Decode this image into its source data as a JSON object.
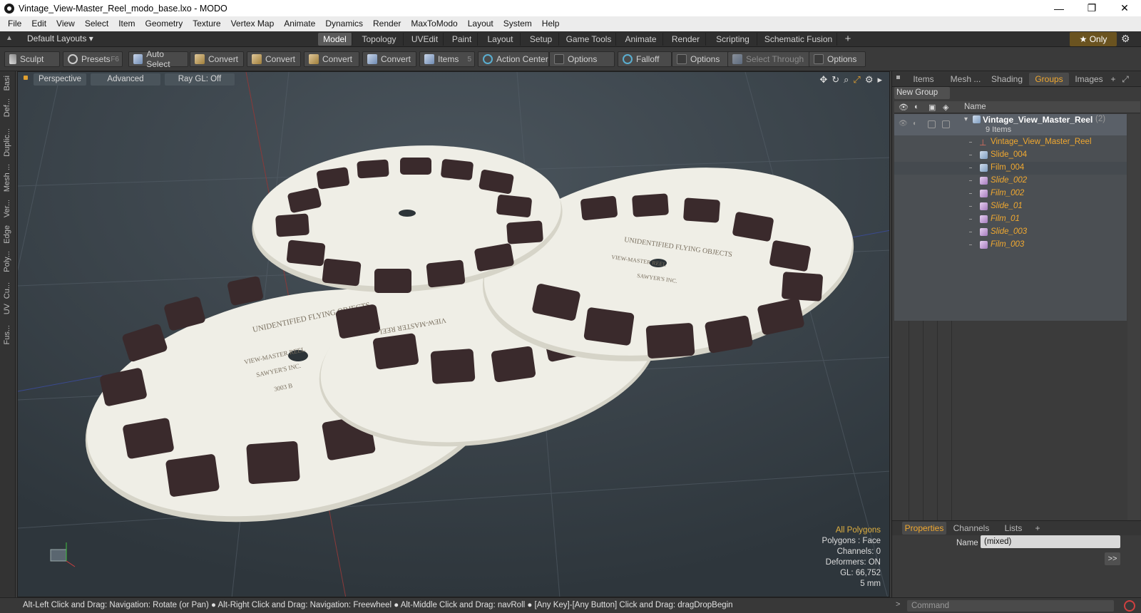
{
  "window": {
    "title": "Vintage_View-Master_Reel_modo_base.lxo - MODO",
    "minimize": "—",
    "maximize": "❐",
    "close": "✕"
  },
  "menu": [
    "File",
    "Edit",
    "View",
    "Select",
    "Item",
    "Geometry",
    "Texture",
    "Vertex Map",
    "Animate",
    "Dynamics",
    "Render",
    "MaxToModo",
    "Layout",
    "System",
    "Help"
  ],
  "layouts": {
    "label": "Default Layouts ▾",
    "plus": "+"
  },
  "layout_tabs": [
    {
      "label": "Model",
      "active": true
    },
    {
      "label": "Topology"
    },
    {
      "label": "UVEdit"
    },
    {
      "label": "Paint"
    },
    {
      "label": "Layout"
    },
    {
      "label": "Setup"
    },
    {
      "label": "Game Tools"
    },
    {
      "label": "Animate"
    },
    {
      "label": "Render"
    },
    {
      "label": "Scripting"
    },
    {
      "label": "Schematic Fusion"
    }
  ],
  "only_button": "★ Only",
  "toolbar": [
    {
      "label": "Sculpt"
    },
    {
      "label": "Presets",
      "key": "F6"
    },
    {
      "label": "Auto Select"
    },
    {
      "label": "Convert"
    },
    {
      "label": "Convert"
    },
    {
      "label": "Convert"
    },
    {
      "label": "Convert"
    },
    {
      "label": "Items",
      "key": "5"
    },
    {
      "label": "Action Center"
    },
    {
      "label": "Options"
    },
    {
      "label": "Falloff"
    },
    {
      "label": "Options"
    },
    {
      "label": "Select Through"
    },
    {
      "label": "Options"
    }
  ],
  "left_tabs": [
    "Basi",
    "Def...",
    "Duplic...",
    "Mesh ...",
    "Ver...",
    "Edge",
    "Poly...",
    "Cu...",
    "UV",
    "Fus..."
  ],
  "viewport": {
    "buttons": [
      "Perspective",
      "Advanced",
      "Ray GL: Off"
    ],
    "info": {
      "mode": "All Polygons",
      "polygons": "Polygons : Face",
      "channels": "Channels: 0",
      "deformers": "Deformers: ON",
      "gl": "GL: 66,752",
      "scale": "5 mm"
    }
  },
  "reels": {
    "text_a": "UNIDENTIFIED FLYING OBJECTS",
    "text_b": "VIEW-MASTER REEL",
    "text_c": "SAWYER'S INC.",
    "text_d": "3003 B"
  },
  "right_panel": {
    "tabs": [
      {
        "label": "Items"
      },
      {
        "label": "Mesh ..."
      },
      {
        "label": "Shading"
      },
      {
        "label": "Groups",
        "active": true
      },
      {
        "label": "Images"
      }
    ],
    "new_group": "New Group",
    "name_header": "Name",
    "group": {
      "name": "Vintage_View_Master_Reel",
      "count": "(2)",
      "items": "9 Items"
    },
    "rows": [
      {
        "label": "Vintage_View_Master_Reel",
        "kind": "locator"
      },
      {
        "label": "Slide_004",
        "kind": "mesh"
      },
      {
        "label": "Film_004",
        "kind": "mesh"
      },
      {
        "label": "Slide_002",
        "kind": "mesh-inactive"
      },
      {
        "label": "Film_002",
        "kind": "mesh-inactive"
      },
      {
        "label": "Slide_01",
        "kind": "mesh-inactive"
      },
      {
        "label": "Film_01",
        "kind": "mesh-inactive"
      },
      {
        "label": "Slide_003",
        "kind": "mesh-inactive"
      },
      {
        "label": "Film_003",
        "kind": "mesh-inactive"
      }
    ]
  },
  "properties": {
    "tabs": [
      "Properties",
      "Channels",
      "Lists"
    ],
    "name_label": "Name",
    "name_value": "(mixed)",
    "more": ">>"
  },
  "status": "Alt-Left Click and Drag: Navigation: Rotate (or Pan) ● Alt-Right Click and Drag: Navigation: Freewheel ● Alt-Middle Click and Drag: navRoll ● [Any Key]-[Any Button] Click and Drag: dragDropBegin",
  "command": {
    "placeholder": "Command"
  },
  "colors": {
    "accent": "#f0a830",
    "viewport_bg": "#3a444b",
    "reel": "#efeee6",
    "slot": "#3a2a2c"
  }
}
